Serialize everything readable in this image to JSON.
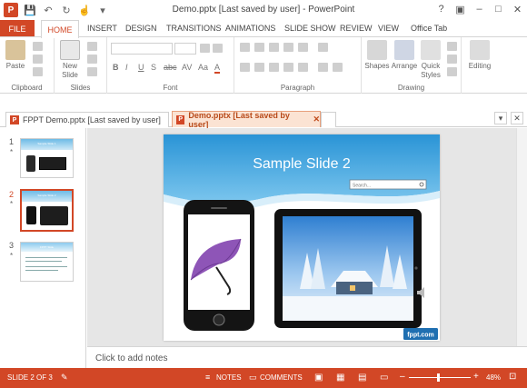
{
  "window": {
    "title": "Demo.pptx [Last saved by user] - PowerPoint",
    "logo_letter": "P",
    "help": "?",
    "ribbon_options": "▣",
    "minimize": "–",
    "maximize": "□",
    "close": "✕"
  },
  "qat": {
    "save": "💾",
    "undo": "↶",
    "redo": "↻",
    "touch": "☝",
    "more": "▾"
  },
  "ribbon_tabs": [
    "HOME",
    "INSERT",
    "DESIGN",
    "TRANSITIONS",
    "ANIMATIONS",
    "SLIDE SHOW",
    "REVIEW",
    "VIEW",
    "Office Tab"
  ],
  "file_tab": "FILE",
  "groups": {
    "clipboard": {
      "label": "Clipboard",
      "paste": "Paste"
    },
    "slides": {
      "label": "Slides",
      "new_slide": "New\nSlide"
    },
    "font": {
      "label": "Font"
    },
    "paragraph": {
      "label": "Paragraph"
    },
    "drawing": {
      "label": "Drawing",
      "shapes": "Shapes",
      "arrange": "Arrange",
      "quick_styles": "Quick\nStyles"
    },
    "editing": {
      "label": "Editing"
    }
  },
  "format_buttons": [
    "B",
    "I",
    "U",
    "S",
    "abc",
    "AV",
    "Aa",
    "A"
  ],
  "doc_tabs": {
    "tab1": "FPPT Demo.pptx [Last saved by user]",
    "tab2": "Demo.pptx [Last saved by user]",
    "close": "✕"
  },
  "slides": [
    {
      "num": "1",
      "star": "*"
    },
    {
      "num": "2",
      "star": "*"
    },
    {
      "num": "3",
      "star": "*"
    }
  ],
  "thumb_text": {
    "t1_title": "Sample Slide 1",
    "t2_title": "Sample Slide 2",
    "t3_title": "FPPT Slide"
  },
  "slide": {
    "title": "Sample Slide 2",
    "search_placeholder": "Search...",
    "brand": "fppt.com"
  },
  "notes_placeholder": "Click to add notes",
  "status": {
    "slide_of": "SLIDE 2 OF 3",
    "notes": "NOTES",
    "comments": "COMMENTS",
    "zoom": "48%",
    "minus": "–",
    "plus": "+"
  },
  "colors": {
    "accent": "#d24726",
    "slide_header": "#3a9fdc"
  }
}
